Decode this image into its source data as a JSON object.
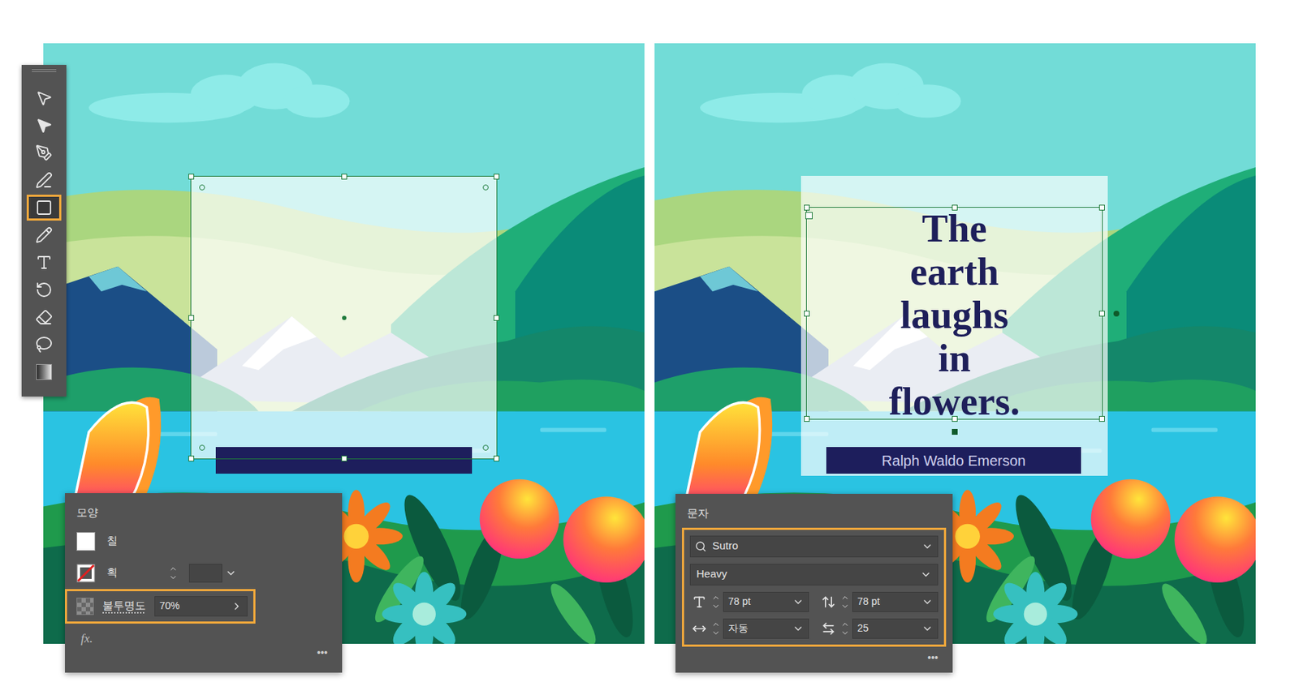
{
  "toolbar": {
    "tools": [
      {
        "selected": false
      },
      {
        "selected": false
      },
      {
        "selected": false
      },
      {
        "selected": false
      },
      {
        "selected": true
      },
      {
        "selected": false
      },
      {
        "selected": false
      },
      {
        "selected": false
      },
      {
        "selected": false
      },
      {
        "selected": false
      },
      {
        "selected": false
      }
    ]
  },
  "appearance_panel": {
    "title": "모양",
    "fill": {
      "label": "칠",
      "color": "#ffffff"
    },
    "stroke": {
      "label": "획",
      "value": ""
    },
    "opacity": {
      "label": "불투명도",
      "value": "70%",
      "level": 0.7,
      "highlighted": true
    },
    "fx": "fx.",
    "more": "•••"
  },
  "character_panel": {
    "title": "문자",
    "font_family": "Sutro",
    "font_style": "Heavy",
    "font_size": "78 pt",
    "leading": "78 pt",
    "kerning": "자동",
    "tracking": "25",
    "highlighted": true,
    "more": "•••"
  },
  "left_artboard": {
    "box_selected": true,
    "box_opacity": 0.7,
    "bar_text": ""
  },
  "right_artboard": {
    "box_opacity": 0.7,
    "quote_lines": [
      "The",
      "earth",
      "laughs",
      "in",
      "flowers."
    ],
    "text_selected": true,
    "bar_text": "Ralph Waldo Emerson"
  }
}
